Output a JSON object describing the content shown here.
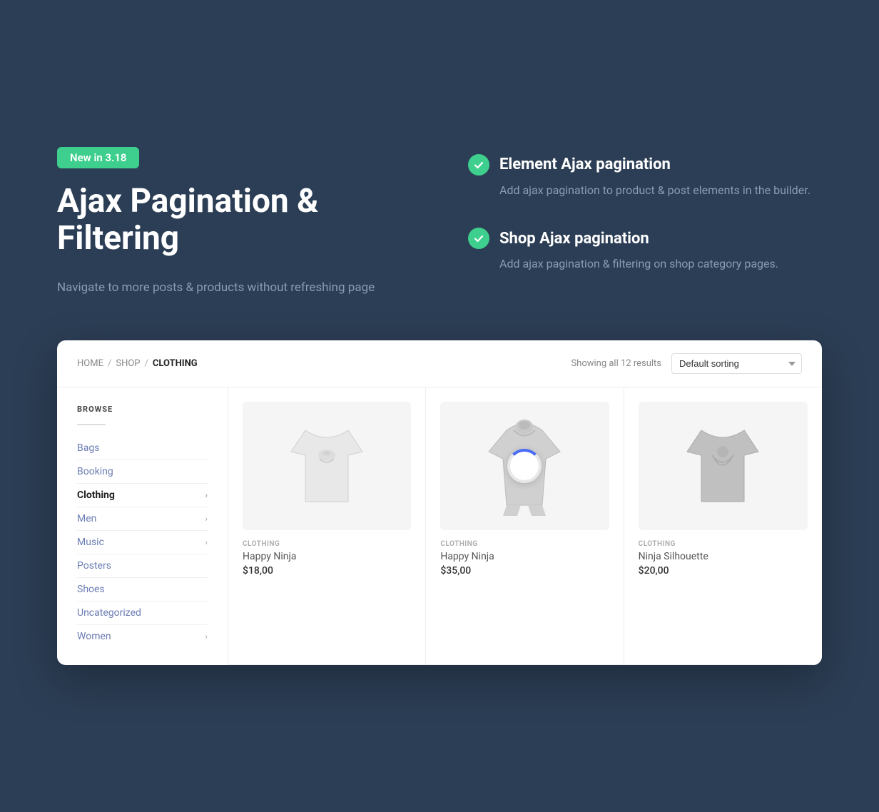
{
  "badge": {
    "label": "New in 3.18"
  },
  "hero": {
    "title": "Ajax Pagination & Filtering",
    "description": "Navigate to more posts & products without refreshing page"
  },
  "features": [
    {
      "title": "Element Ajax pagination",
      "description": "Add ajax pagination to product & post elements in the builder."
    },
    {
      "title": "Shop Ajax pagination",
      "description": "Add ajax pagination & filtering on shop category pages."
    }
  ],
  "shop": {
    "breadcrumb": {
      "home": "HOME",
      "sep1": "/",
      "shop": "SHOP",
      "sep2": "/",
      "active": "CLOTHING"
    },
    "results_text": "Showing all 12 results",
    "sort_label": "Default sorting",
    "browse_title": "BROWSE",
    "categories": [
      {
        "label": "Bags",
        "active": false,
        "has_chevron": false
      },
      {
        "label": "Booking",
        "active": false,
        "has_chevron": false
      },
      {
        "label": "Clothing",
        "active": true,
        "has_chevron": true
      },
      {
        "label": "Men",
        "active": false,
        "has_chevron": true
      },
      {
        "label": "Music",
        "active": false,
        "has_chevron": true
      },
      {
        "label": "Posters",
        "active": false,
        "has_chevron": false
      },
      {
        "label": "Shoes",
        "active": false,
        "has_chevron": false
      },
      {
        "label": "Uncategorized",
        "active": false,
        "has_chevron": false
      },
      {
        "label": "Women",
        "active": false,
        "has_chevron": true
      }
    ],
    "products": [
      {
        "category": "CLOTHING",
        "name": "Happy Ninja",
        "price": "$18,00",
        "type": "tshirt-light",
        "loading": false
      },
      {
        "category": "CLOTHING",
        "name": "Happy Ninja",
        "price": "$35,00",
        "type": "hoodie",
        "loading": true
      },
      {
        "category": "CLOTHING",
        "name": "Ninja Silhouette",
        "price": "$20,00",
        "type": "tshirt-dark",
        "loading": false
      }
    ]
  }
}
